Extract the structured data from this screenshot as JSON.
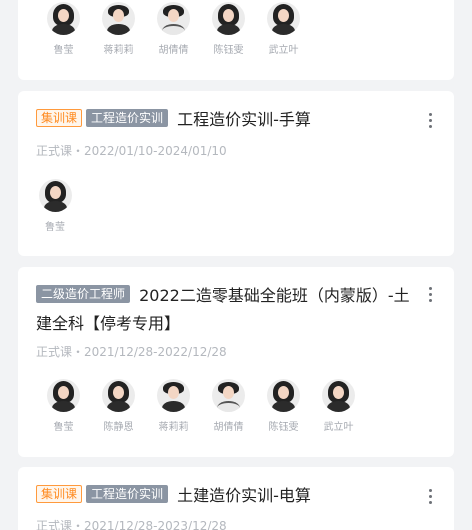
{
  "courses": [
    {
      "teachers": [
        "鲁莹",
        "蒋莉莉",
        "胡倩倩",
        "陈钰雯",
        "武立叶"
      ]
    },
    {
      "tags": [
        "集训课",
        "工程造价实训"
      ],
      "title": "工程造价实训-手算",
      "meta": "正式课・2022/01/10-2024/01/10",
      "teachers": [
        "鲁莹"
      ]
    },
    {
      "tags": [
        "二级造价工程师"
      ],
      "title": "2022二造零基础全能班（内蒙版）-土建全科【停考专用】",
      "meta": "正式课・2021/12/28-2022/12/28",
      "teachers": [
        "鲁莹",
        "陈静恩",
        "蒋莉莉",
        "胡倩倩",
        "陈钰雯",
        "武立叶"
      ]
    },
    {
      "tags": [
        "集训课",
        "工程造价实训"
      ],
      "title": "土建造价实训-电算",
      "meta": "正式课・2021/12/28-2023/12/28"
    }
  ],
  "colors": {
    "tag_orange": "#ff8a1f",
    "tag_gray": "#8b95a3",
    "background": "#f2f3f5"
  },
  "icons": {
    "more": "more-vertical-icon",
    "avatar": "teacher-avatar"
  }
}
